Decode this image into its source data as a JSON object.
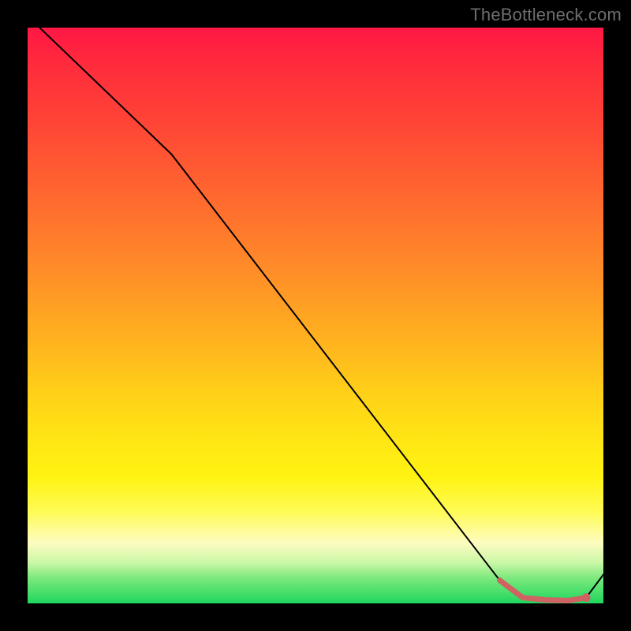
{
  "watermark": "TheBottleneck.com",
  "colors": {
    "background": "#000000",
    "gradient_top": "#ff1744",
    "gradient_mid_orange": "#ff8c28",
    "gradient_yellow": "#fff312",
    "gradient_cream": "#fdfcc0",
    "gradient_green": "#1fd65e",
    "curve": "#000000",
    "marker": "#d36b6b"
  },
  "chart_data": {
    "type": "line",
    "title": "",
    "xlabel": "",
    "ylabel": "",
    "xlim": [
      0,
      100
    ],
    "ylim": [
      0,
      100
    ],
    "grid": false,
    "legend": null,
    "series": [
      {
        "name": "curve",
        "x": [
          0,
          25,
          82,
          86,
          94,
          97,
          100
        ],
        "values": [
          102,
          78,
          4,
          1,
          0.5,
          1,
          5
        ]
      }
    ],
    "markers": {
      "name": "highlight-segment",
      "x": [
        82,
        86,
        90,
        94,
        97
      ],
      "values": [
        4,
        1,
        0.6,
        0.5,
        1
      ]
    }
  }
}
